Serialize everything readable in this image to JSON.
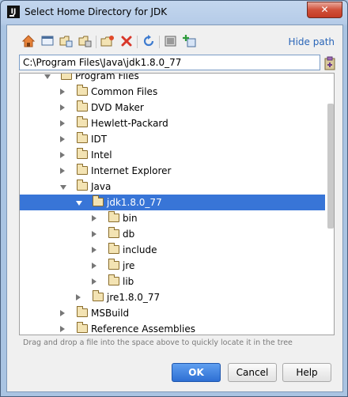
{
  "window": {
    "title": "Select Home Directory for JDK",
    "close_label": "✕",
    "app_icon_text": "IJ"
  },
  "toolbar": {
    "hide_path_label": "Hide path",
    "icons": [
      "home-icon",
      "desktop-icon",
      "project-folder-icon",
      "module-folder-icon",
      "new-folder-icon",
      "delete-icon",
      "refresh-icon",
      "show-hidden-icon",
      "add-library-icon"
    ]
  },
  "path_field": {
    "value": "C:\\Program Files\\Java\\jdk1.8.0_77"
  },
  "tree": {
    "rows": [
      {
        "label": "Program Files",
        "level": 0,
        "state": "expanded",
        "partial": true
      },
      {
        "label": "Common Files",
        "level": 1,
        "state": "collapsed"
      },
      {
        "label": "DVD Maker",
        "level": 1,
        "state": "collapsed"
      },
      {
        "label": "Hewlett-Packard",
        "level": 1,
        "state": "collapsed"
      },
      {
        "label": "IDT",
        "level": 1,
        "state": "collapsed"
      },
      {
        "label": "Intel",
        "level": 1,
        "state": "collapsed"
      },
      {
        "label": "Internet Explorer",
        "level": 1,
        "state": "collapsed"
      },
      {
        "label": "Java",
        "level": 1,
        "state": "expanded"
      },
      {
        "label": "jdk1.8.0_77",
        "level": 2,
        "state": "expanded",
        "selected": true
      },
      {
        "label": "bin",
        "level": 3,
        "state": "collapsed"
      },
      {
        "label": "db",
        "level": 3,
        "state": "collapsed"
      },
      {
        "label": "include",
        "level": 3,
        "state": "collapsed"
      },
      {
        "label": "jre",
        "level": 3,
        "state": "collapsed"
      },
      {
        "label": "lib",
        "level": 3,
        "state": "collapsed"
      },
      {
        "label": "jre1.8.0_77",
        "level": 2,
        "state": "collapsed"
      },
      {
        "label": "MSBuild",
        "level": 1,
        "state": "collapsed"
      },
      {
        "label": "Reference Assemblies",
        "level": 1,
        "state": "collapsed"
      }
    ]
  },
  "hint": "Drag and drop a file into the space above to quickly locate it in the tree",
  "buttons": {
    "ok": "OK",
    "cancel": "Cancel",
    "help": "Help"
  },
  "colors": {
    "selection": "#3875d7",
    "link": "#2965b8",
    "ok_button": "#2e6fd3"
  }
}
